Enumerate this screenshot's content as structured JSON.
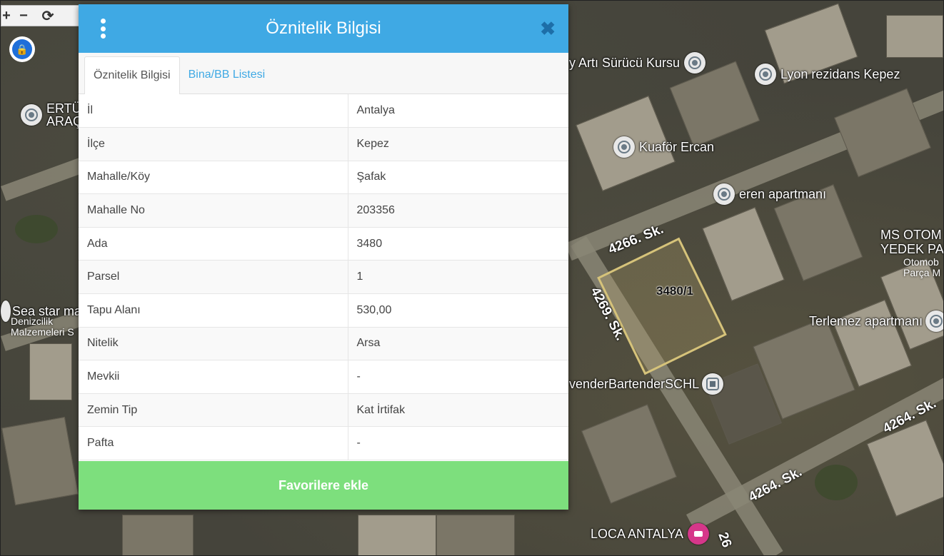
{
  "map": {
    "controls": {
      "pan_glyph": "+",
      "zoom_out_glyph": "−",
      "refresh_glyph": "⟳"
    },
    "poi": [
      {
        "name": "ERTÜ ARAÇ",
        "lines": [
          "ERTÜ",
          "ARAÇ"
        ]
      },
      {
        "name": "y Artı Sürücü Kursu"
      },
      {
        "name": "Lyon rezidans Kepez"
      },
      {
        "name": "Kuaför Ercan"
      },
      {
        "name": "eren apartmanı"
      },
      {
        "name": "Terlemez apartmanı"
      },
      {
        "name": "venderBartenderSCHL"
      },
      {
        "name": "LOCA ANTALYA"
      },
      {
        "name": "Sea star ma",
        "sub": [
          "Denizcilik",
          "Malzemeleri S"
        ]
      },
      {
        "name": "MS OTOM YEDEK PA",
        "lines": [
          "MS OTOM",
          "YEDEK PA"
        ],
        "sub": [
          "Otomob",
          "Parça M"
        ]
      }
    ],
    "streets": [
      "4266. Sk.",
      "4269. Sk.",
      "4264. Sk.",
      "4264. Sk.",
      "26"
    ],
    "parcel_label": "3480/1"
  },
  "dialog": {
    "title": "Öznitelik Bilgisi",
    "tabs": [
      {
        "label": "Öznitelik Bilgisi",
        "active": true
      },
      {
        "label": "Bina/BB Listesi",
        "active": false
      }
    ],
    "rows": [
      {
        "key": "İl",
        "value": "Antalya"
      },
      {
        "key": "İlçe",
        "value": "Kepez"
      },
      {
        "key": "Mahalle/Köy",
        "value": "Şafak"
      },
      {
        "key": "Mahalle No",
        "value": "203356"
      },
      {
        "key": "Ada",
        "value": "3480"
      },
      {
        "key": "Parsel",
        "value": "1"
      },
      {
        "key": "Tapu Alanı",
        "value": "530,00"
      },
      {
        "key": "Nitelik",
        "value": "Arsa"
      },
      {
        "key": "Mevkii",
        "value": "-"
      },
      {
        "key": "Zemin Tip",
        "value": "Kat İrtifak"
      },
      {
        "key": "Pafta",
        "value": "-"
      }
    ],
    "favorite_button": "Favorilere ekle"
  },
  "colors": {
    "header": "#3fa9e4",
    "close": "#1d6ea8",
    "favorite": "#7ddf7d",
    "parcel_outline": "#d6c37a"
  }
}
